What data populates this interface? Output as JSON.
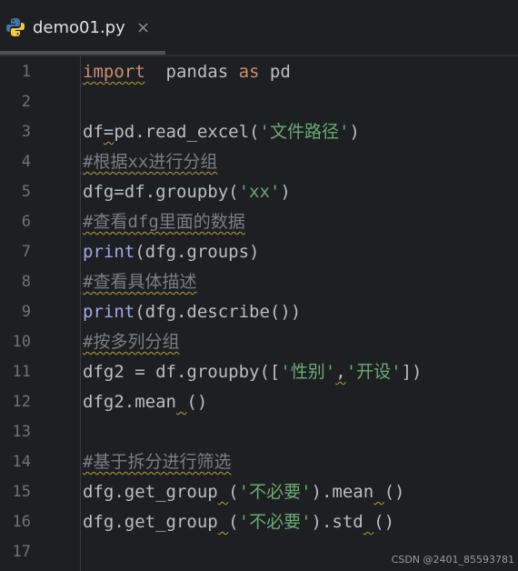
{
  "tab": {
    "title": "demo01.py",
    "close": "×"
  },
  "lines": [
    {
      "n": "1",
      "parts": [
        {
          "t": "import",
          "c": "kw squig"
        },
        {
          "t": "  pandas ",
          "c": ""
        },
        {
          "t": "as",
          "c": "kw"
        },
        {
          "t": " pd",
          "c": ""
        }
      ]
    },
    {
      "n": "2",
      "parts": []
    },
    {
      "n": "3",
      "parts": [
        {
          "t": "df",
          "c": ""
        },
        {
          "t": "=",
          "c": "squig"
        },
        {
          "t": "pd.read_excel(",
          "c": ""
        },
        {
          "t": "'文件路径'",
          "c": "str"
        },
        {
          "t": ")",
          "c": ""
        }
      ]
    },
    {
      "n": "4",
      "parts": [
        {
          "t": "#根据xx进行分组",
          "c": "cmt squig"
        }
      ]
    },
    {
      "n": "5",
      "parts": [
        {
          "t": "dfg=df.groupby(",
          "c": ""
        },
        {
          "t": "'xx'",
          "c": "str"
        },
        {
          "t": ")",
          "c": ""
        }
      ]
    },
    {
      "n": "6",
      "parts": [
        {
          "t": "#查看dfg里面的数据",
          "c": "cmt squig"
        }
      ]
    },
    {
      "n": "7",
      "parts": [
        {
          "t": "print",
          "c": "fn"
        },
        {
          "t": "(dfg.groups)",
          "c": ""
        }
      ]
    },
    {
      "n": "8",
      "parts": [
        {
          "t": "#查看具体描述",
          "c": "cmt squig"
        }
      ]
    },
    {
      "n": "9",
      "parts": [
        {
          "t": "print",
          "c": "fn"
        },
        {
          "t": "(dfg.describe())",
          "c": ""
        }
      ]
    },
    {
      "n": "10",
      "parts": [
        {
          "t": "#按多列分组",
          "c": "cmt squig"
        }
      ]
    },
    {
      "n": "11",
      "parts": [
        {
          "t": "dfg2 = df.groupby([",
          "c": ""
        },
        {
          "t": "'性别'",
          "c": "str"
        },
        {
          "t": ",",
          "c": "squig"
        },
        {
          "t": "'开设'",
          "c": "str"
        },
        {
          "t": "])",
          "c": ""
        }
      ]
    },
    {
      "n": "12",
      "parts": [
        {
          "t": "dfg2.mean",
          "c": ""
        },
        {
          "t": " ",
          "c": "squig"
        },
        {
          "t": "()",
          "c": ""
        }
      ]
    },
    {
      "n": "13",
      "parts": []
    },
    {
      "n": "14",
      "parts": [
        {
          "t": "#基于拆分进行筛选",
          "c": "cmt squig"
        }
      ]
    },
    {
      "n": "15",
      "parts": [
        {
          "t": "dfg.get_group",
          "c": ""
        },
        {
          "t": " ",
          "c": "squig"
        },
        {
          "t": "(",
          "c": ""
        },
        {
          "t": "'不必要'",
          "c": "str"
        },
        {
          "t": ").mean",
          "c": ""
        },
        {
          "t": " ",
          "c": "squig"
        },
        {
          "t": "()",
          "c": ""
        }
      ]
    },
    {
      "n": "16",
      "parts": [
        {
          "t": "dfg.get_group",
          "c": ""
        },
        {
          "t": " ",
          "c": "squig"
        },
        {
          "t": "(",
          "c": ""
        },
        {
          "t": "'不必要'",
          "c": "str"
        },
        {
          "t": ").std",
          "c": ""
        },
        {
          "t": " ",
          "c": "squig"
        },
        {
          "t": "()",
          "c": ""
        }
      ]
    },
    {
      "n": "17",
      "parts": []
    }
  ],
  "watermark": "CSDN @2401_85593781",
  "colors": {
    "background": "#1e1f22",
    "keyword": "#cf8e6d",
    "function": "#a0a8e8",
    "string": "#6aab73",
    "comment": "#7a7e85",
    "text": "#bcbec4"
  },
  "icons": {
    "file": "python-icon"
  }
}
